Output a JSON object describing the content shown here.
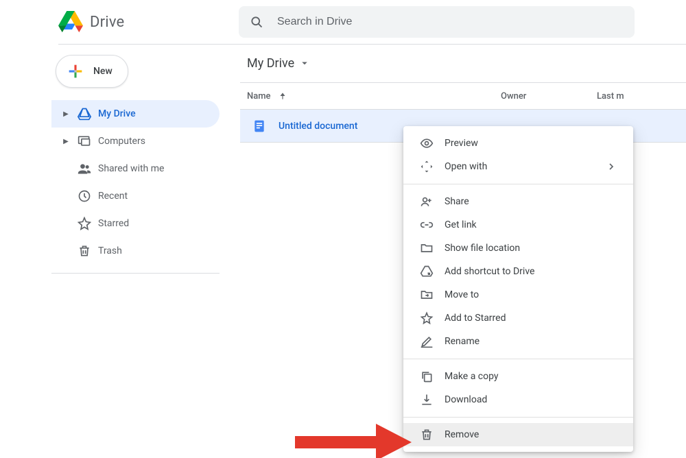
{
  "header": {
    "product": "Drive",
    "search_placeholder": "Search in Drive"
  },
  "sidebar": {
    "new_label": "New",
    "items": [
      {
        "label": "My Drive"
      },
      {
        "label": "Computers"
      },
      {
        "label": "Shared with me"
      },
      {
        "label": "Recent"
      },
      {
        "label": "Starred"
      },
      {
        "label": "Trash"
      }
    ]
  },
  "main": {
    "breadcrumb": "My Drive",
    "columns": {
      "name": "Name",
      "owner": "Owner",
      "modified": "Last m"
    },
    "rows": [
      {
        "filename": "Untitled document"
      }
    ]
  },
  "menu": {
    "items": [
      {
        "key": "preview",
        "label": "Preview"
      },
      {
        "key": "open_with",
        "label": "Open with",
        "has_submenu": true
      },
      {
        "divider": true
      },
      {
        "key": "share",
        "label": "Share"
      },
      {
        "key": "get_link",
        "label": "Get link"
      },
      {
        "key": "show_loc",
        "label": "Show file location"
      },
      {
        "key": "shortcut",
        "label": "Add shortcut to Drive"
      },
      {
        "key": "move_to",
        "label": "Move to"
      },
      {
        "key": "starred",
        "label": "Add to Starred"
      },
      {
        "key": "rename",
        "label": "Rename"
      },
      {
        "divider": true
      },
      {
        "key": "copy",
        "label": "Make a copy"
      },
      {
        "key": "download",
        "label": "Download"
      },
      {
        "divider": true
      },
      {
        "key": "remove",
        "label": "Remove",
        "highlighted": true
      }
    ]
  }
}
